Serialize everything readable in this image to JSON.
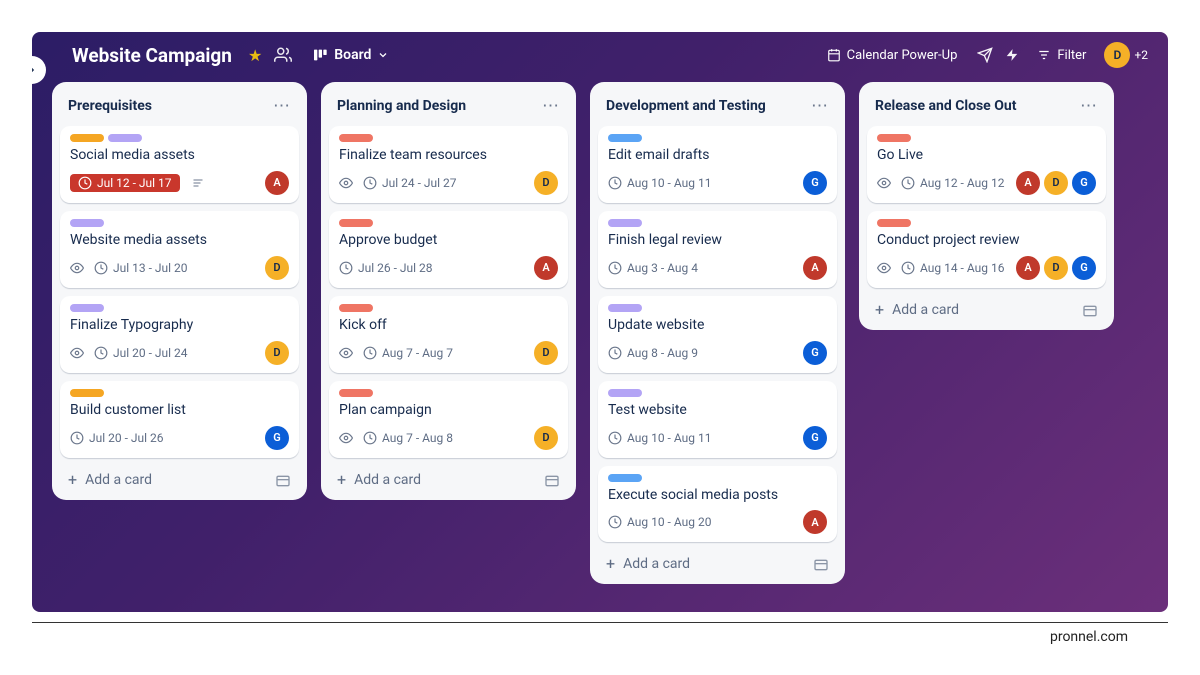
{
  "header": {
    "title": "Website Campaign",
    "view_label": "Board",
    "calendar_label": "Calendar Power-Up",
    "filter_label": "Filter",
    "user_initial": "D",
    "more_count": "+2"
  },
  "add_card_label": "Add a card",
  "footer_text": "pronnel.com",
  "label_colors": {
    "orange": "#f5a623",
    "purple": "#b3a4f5",
    "red": "#ef7564",
    "blue": "#5ba4f5"
  },
  "avatar_colors": {
    "A": "#c0392b",
    "D": "#f5b027",
    "G": "#0b5ed7"
  },
  "lists": [
    {
      "title": "Prerequisites",
      "cards": [
        {
          "labels": [
            "orange",
            "purple"
          ],
          "title": "Social media assets",
          "watch": false,
          "date": "Jul 12 - Jul 17",
          "due": true,
          "desc": true,
          "members": [
            "A"
          ]
        },
        {
          "labels": [
            "purple"
          ],
          "title": "Website media assets",
          "watch": true,
          "date": "Jul 13 - Jul 20",
          "due": false,
          "desc": false,
          "members": [
            "D"
          ]
        },
        {
          "labels": [
            "purple"
          ],
          "title": "Finalize Typography",
          "watch": true,
          "date": "Jul 20 - Jul 24",
          "due": false,
          "desc": false,
          "members": [
            "D"
          ]
        },
        {
          "labels": [
            "orange"
          ],
          "title": "Build customer list",
          "watch": false,
          "date": "Jul 20 - Jul 26",
          "due": false,
          "desc": false,
          "members": [
            "G"
          ]
        }
      ]
    },
    {
      "title": "Planning and Design",
      "cards": [
        {
          "labels": [
            "red"
          ],
          "title": "Finalize team resources",
          "watch": true,
          "date": "Jul 24 - Jul 27",
          "due": false,
          "desc": false,
          "members": [
            "D"
          ]
        },
        {
          "labels": [
            "red"
          ],
          "title": "Approve budget",
          "watch": false,
          "date": "Jul 26 - Jul 28",
          "due": false,
          "desc": false,
          "members": [
            "A"
          ]
        },
        {
          "labels": [
            "red"
          ],
          "title": "Kick off",
          "watch": true,
          "date": "Aug 7 - Aug 7",
          "due": false,
          "desc": false,
          "members": [
            "D"
          ]
        },
        {
          "labels": [
            "red"
          ],
          "title": "Plan campaign",
          "watch": true,
          "date": "Aug 7 - Aug 8",
          "due": false,
          "desc": false,
          "members": [
            "D"
          ]
        }
      ]
    },
    {
      "title": "Development and Testing",
      "cards": [
        {
          "labels": [
            "blue"
          ],
          "title": "Edit email drafts",
          "watch": false,
          "date": "Aug 10 - Aug 11",
          "due": false,
          "desc": false,
          "members": [
            "G"
          ]
        },
        {
          "labels": [
            "purple"
          ],
          "title": "Finish legal review",
          "watch": false,
          "date": "Aug 3 - Aug 4",
          "due": false,
          "desc": false,
          "members": [
            "A"
          ]
        },
        {
          "labels": [
            "purple"
          ],
          "title": "Update website",
          "watch": false,
          "date": "Aug 8 - Aug 9",
          "due": false,
          "desc": false,
          "members": [
            "G"
          ]
        },
        {
          "labels": [
            "purple"
          ],
          "title": "Test website",
          "watch": false,
          "date": "Aug 10 - Aug 11",
          "due": false,
          "desc": false,
          "members": [
            "G"
          ]
        },
        {
          "labels": [
            "blue"
          ],
          "title": "Execute social media posts",
          "watch": false,
          "date": "Aug 10 - Aug 20",
          "due": false,
          "desc": false,
          "members": [
            "A"
          ]
        }
      ]
    },
    {
      "title": "Release and Close Out",
      "cards": [
        {
          "labels": [
            "red"
          ],
          "title": "Go Live",
          "watch": true,
          "date": "Aug 12 - Aug 12",
          "due": false,
          "desc": false,
          "members": [
            "A",
            "D",
            "G"
          ]
        },
        {
          "labels": [
            "red"
          ],
          "title": "Conduct project review",
          "watch": true,
          "date": "Aug 14 - Aug 16",
          "due": false,
          "desc": false,
          "members": [
            "A",
            "D",
            "G"
          ]
        }
      ]
    }
  ]
}
